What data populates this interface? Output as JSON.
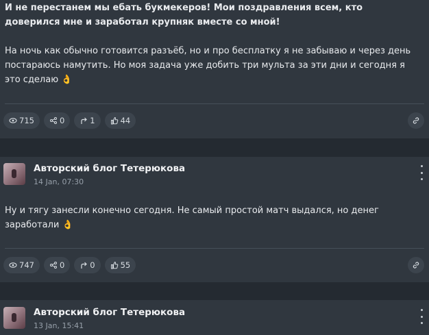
{
  "posts": [
    {
      "paragraphs": [
        "И не перестанем мы ебать букмекеров! Мои поздравления всем, кто доверился мне и заработал крупняк вместе со мной!",
        "На ночь как обычно готовится разъёб, но и про бесплатку я не забываю и через день постараюсь намутить. Но моя задача уже добить три мульта за эти дни и сегодня я это сделаю 👌"
      ],
      "stats": {
        "views": "715",
        "shares": "0",
        "forwards": "1",
        "likes": "44"
      }
    },
    {
      "author": "Авторский блог Тетерюкова",
      "date": "14 Jan, 07:30",
      "paragraphs": [
        "Ну и тягу занесли конечно сегодня. Не самый простой матч выдался, но денег заработали 👌"
      ],
      "stats": {
        "views": "747",
        "shares": "0",
        "forwards": "0",
        "likes": "55"
      }
    },
    {
      "author": "Авторский блог Тетерюкова",
      "date": "13 Jan, 15:41"
    }
  ]
}
